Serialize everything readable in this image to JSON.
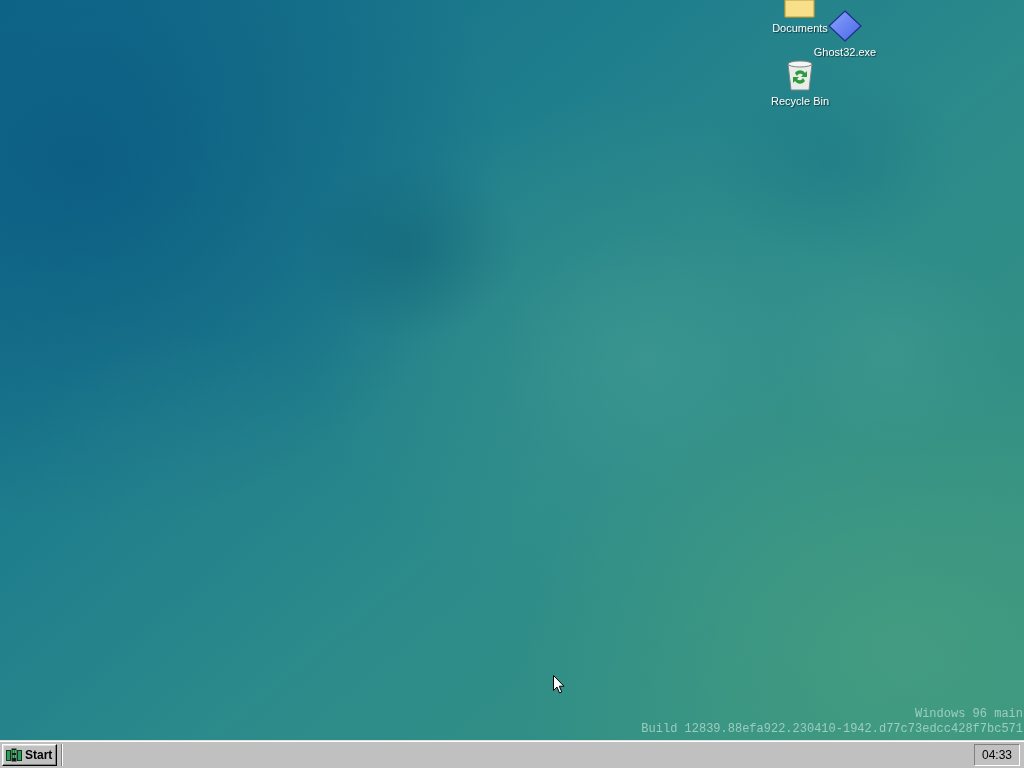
{
  "desktop": {
    "icons": [
      {
        "label": "Documents",
        "kind": "folder"
      },
      {
        "label": "Ghost32.exe",
        "kind": "app"
      },
      {
        "label": "Recycle Bin",
        "kind": "recycle-bin"
      }
    ],
    "watermark": [
      "Windows 96 main",
      "Build 12839.88efa922.230410-1942.d77c73edcc428f7bc571"
    ]
  },
  "taskbar": {
    "start_button": "Start",
    "clock": "04:33"
  }
}
